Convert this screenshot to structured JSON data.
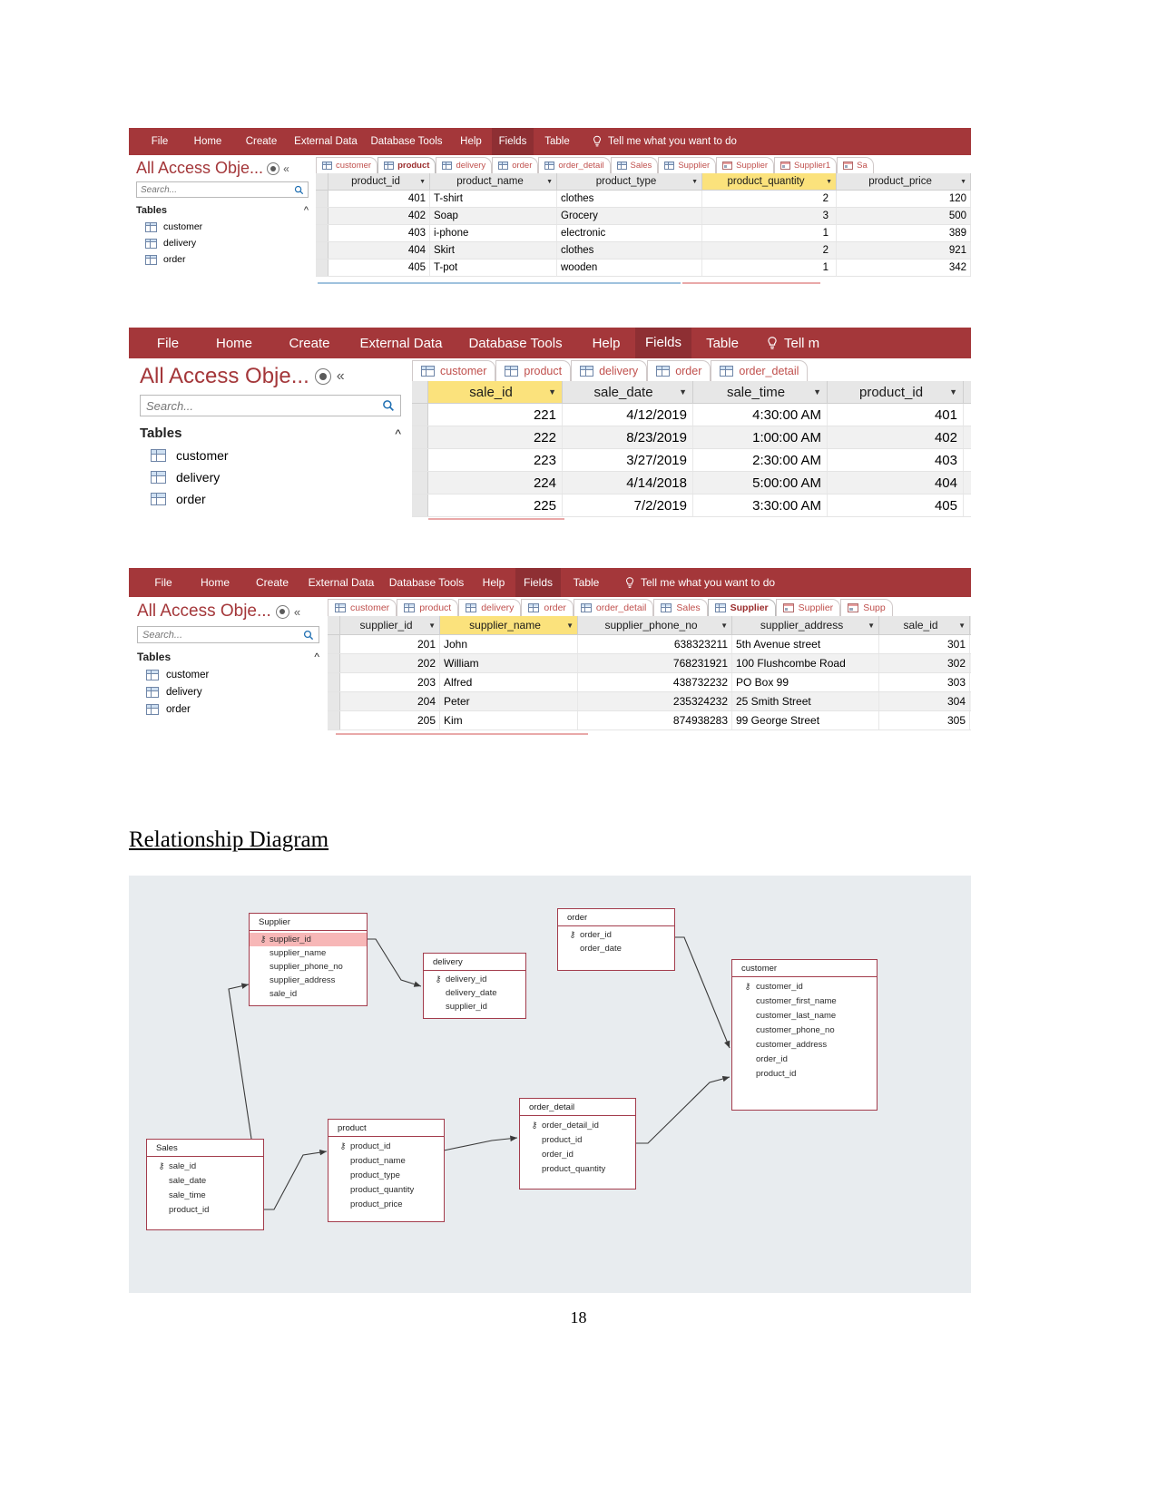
{
  "document": {
    "section_heading": "Relationship Diagram",
    "page_number": "18"
  },
  "icons": {
    "search": "search-icon",
    "bulb": "lightbulb-icon",
    "caret_down": "chevron-down-icon",
    "chevron_up": "chevron-up-icon",
    "collapse": "collapse-pane-icon",
    "eye": "shutter-bar-icon",
    "key": "primary-key-icon",
    "table": "table-icon"
  },
  "ribbon": {
    "tabs": [
      "File",
      "Home",
      "Create",
      "External Data",
      "Database Tools",
      "Help",
      "Fields",
      "Table"
    ],
    "active_tab": "Fields",
    "tell_me": "Tell me what you want to do",
    "tell_me_short": "Tell m",
    "color": "#a4373a"
  },
  "navpane": {
    "title": "All Access Obje...",
    "search_placeholder": "Search...",
    "group_label": "Tables",
    "items": [
      {
        "label": "customer"
      },
      {
        "label": "delivery"
      },
      {
        "label": "order"
      }
    ]
  },
  "screenshots": [
    {
      "id": "product-datasheet",
      "doc_tabs": [
        {
          "label": "customer",
          "type": "table",
          "active": false
        },
        {
          "label": "product",
          "type": "table",
          "active": true
        },
        {
          "label": "delivery",
          "type": "table",
          "active": false
        },
        {
          "label": "order",
          "type": "table",
          "active": false
        },
        {
          "label": "order_detail",
          "type": "table",
          "active": false
        },
        {
          "label": "Sales",
          "type": "table",
          "active": false
        },
        {
          "label": "Supplier",
          "type": "table",
          "active": false
        },
        {
          "label": "Supplier",
          "type": "form",
          "active": false
        },
        {
          "label": "Supplier1",
          "type": "form",
          "active": false
        },
        {
          "label": "Sa",
          "type": "form",
          "active": false
        }
      ],
      "columns": [
        {
          "name": "product_id",
          "selected": false
        },
        {
          "name": "product_name",
          "selected": false
        },
        {
          "name": "product_type",
          "selected": false
        },
        {
          "name": "product_quantity",
          "selected": true
        },
        {
          "name": "product_price",
          "selected": false
        }
      ],
      "rows": [
        {
          "product_id": "401",
          "product_name": "T-shirt",
          "product_type": "clothes",
          "product_quantity": "2",
          "product_price": "120"
        },
        {
          "product_id": "402",
          "product_name": "Soap",
          "product_type": "Grocery",
          "product_quantity": "3",
          "product_price": "500"
        },
        {
          "product_id": "403",
          "product_name": "i-phone",
          "product_type": "electronic",
          "product_quantity": "1",
          "product_price": "389"
        },
        {
          "product_id": "404",
          "product_name": "Skirt",
          "product_type": "clothes",
          "product_quantity": "2",
          "product_price": "921"
        },
        {
          "product_id": "405",
          "product_name": "T-pot",
          "product_type": "wooden",
          "product_quantity": "1",
          "product_price": "342"
        }
      ]
    },
    {
      "id": "sales-datasheet",
      "doc_tabs": [
        {
          "label": "customer",
          "type": "table",
          "active": false
        },
        {
          "label": "product",
          "type": "table",
          "active": false
        },
        {
          "label": "delivery",
          "type": "table",
          "active": false
        },
        {
          "label": "order",
          "type": "table",
          "active": false
        },
        {
          "label": "order_detail",
          "type": "table",
          "active": false
        }
      ],
      "columns": [
        {
          "name": "sale_id",
          "selected": true
        },
        {
          "name": "sale_date",
          "selected": false
        },
        {
          "name": "sale_time",
          "selected": false
        },
        {
          "name": "product_id",
          "selected": false
        }
      ],
      "rows": [
        {
          "sale_id": "221",
          "sale_date": "4/12/2019",
          "sale_time": "4:30:00 AM",
          "product_id": "401"
        },
        {
          "sale_id": "222",
          "sale_date": "8/23/2019",
          "sale_time": "1:00:00 AM",
          "product_id": "402"
        },
        {
          "sale_id": "223",
          "sale_date": "3/27/2019",
          "sale_time": "2:30:00 AM",
          "product_id": "403"
        },
        {
          "sale_id": "224",
          "sale_date": "4/14/2018",
          "sale_time": "5:00:00 AM",
          "product_id": "404"
        },
        {
          "sale_id": "225",
          "sale_date": "7/2/2019",
          "sale_time": "3:30:00 AM",
          "product_id": "405"
        }
      ]
    },
    {
      "id": "supplier-datasheet",
      "doc_tabs": [
        {
          "label": "customer",
          "type": "table",
          "active": false
        },
        {
          "label": "product",
          "type": "table",
          "active": false
        },
        {
          "label": "delivery",
          "type": "table",
          "active": false
        },
        {
          "label": "order",
          "type": "table",
          "active": false
        },
        {
          "label": "order_detail",
          "type": "table",
          "active": false
        },
        {
          "label": "Sales",
          "type": "table",
          "active": false
        },
        {
          "label": "Supplier",
          "type": "table",
          "active": true
        },
        {
          "label": "Supplier",
          "type": "form",
          "active": false
        },
        {
          "label": "Supp",
          "type": "form",
          "active": false
        }
      ],
      "columns": [
        {
          "name": "supplier_id",
          "selected": false
        },
        {
          "name": "supplier_name",
          "selected": true
        },
        {
          "name": "supplier_phone_no",
          "selected": false
        },
        {
          "name": "supplier_address",
          "selected": false
        },
        {
          "name": "sale_id",
          "selected": false
        }
      ],
      "rows": [
        {
          "supplier_id": "201",
          "supplier_name": "John",
          "supplier_phone_no": "638323211",
          "supplier_address": "5th Avenue street",
          "sale_id": "301"
        },
        {
          "supplier_id": "202",
          "supplier_name": "William",
          "supplier_phone_no": "768231921",
          "supplier_address": "100 Flushcombe Road",
          "sale_id": "302"
        },
        {
          "supplier_id": "203",
          "supplier_name": "Alfred",
          "supplier_phone_no": "438732232",
          "supplier_address": "PO Box 99",
          "sale_id": "303"
        },
        {
          "supplier_id": "204",
          "supplier_name": "Peter",
          "supplier_phone_no": "235324232",
          "supplier_address": "25 Smith Street",
          "sale_id": "304"
        },
        {
          "supplier_id": "205",
          "supplier_name": "Kim",
          "supplier_phone_no": "874938283",
          "supplier_address": "99 George Street",
          "sale_id": "305"
        }
      ]
    }
  ],
  "er_diagram": {
    "background": "#e8ecef",
    "border_color": "#a33c4c",
    "pk_highlight_color": "#f7b7b7",
    "entities": [
      {
        "name": "Supplier",
        "fields": [
          {
            "name": "supplier_id",
            "key": true,
            "highlight": true
          },
          {
            "name": "supplier_name",
            "key": false,
            "highlight": false
          },
          {
            "name": "supplier_phone_no",
            "key": false,
            "highlight": false
          },
          {
            "name": "supplier_address",
            "key": false,
            "highlight": false
          },
          {
            "name": "sale_id",
            "key": false,
            "highlight": false
          }
        ]
      },
      {
        "name": "delivery",
        "fields": [
          {
            "name": "delivery_id",
            "key": true,
            "highlight": false
          },
          {
            "name": "delivery_date",
            "key": false,
            "highlight": false
          },
          {
            "name": "supplier_id",
            "key": false,
            "highlight": false
          }
        ]
      },
      {
        "name": "order",
        "fields": [
          {
            "name": "order_id",
            "key": true,
            "highlight": false
          },
          {
            "name": "order_date",
            "key": false,
            "highlight": false
          }
        ]
      },
      {
        "name": "customer",
        "fields": [
          {
            "name": "customer_id",
            "key": true,
            "highlight": false
          },
          {
            "name": "customer_first_name",
            "key": false,
            "highlight": false
          },
          {
            "name": "customer_last_name",
            "key": false,
            "highlight": false
          },
          {
            "name": "customer_phone_no",
            "key": false,
            "highlight": false
          },
          {
            "name": "customer_address",
            "key": false,
            "highlight": false
          },
          {
            "name": "order_id",
            "key": false,
            "highlight": false
          },
          {
            "name": "product_id",
            "key": false,
            "highlight": false
          }
        ]
      },
      {
        "name": "Sales",
        "fields": [
          {
            "name": "sale_id",
            "key": true,
            "highlight": false
          },
          {
            "name": "sale_date",
            "key": false,
            "highlight": false
          },
          {
            "name": "sale_time",
            "key": false,
            "highlight": false
          },
          {
            "name": "product_id",
            "key": false,
            "highlight": false
          }
        ]
      },
      {
        "name": "product",
        "fields": [
          {
            "name": "product_id",
            "key": true,
            "highlight": false
          },
          {
            "name": "product_name",
            "key": false,
            "highlight": false
          },
          {
            "name": "product_type",
            "key": false,
            "highlight": false
          },
          {
            "name": "product_quantity",
            "key": false,
            "highlight": false
          },
          {
            "name": "product_price",
            "key": false,
            "highlight": false
          }
        ]
      },
      {
        "name": "order_detail",
        "fields": [
          {
            "name": "order_detail_id",
            "key": true,
            "highlight": false
          },
          {
            "name": "product_id",
            "key": false,
            "highlight": false
          },
          {
            "name": "order_id",
            "key": false,
            "highlight": false
          },
          {
            "name": "product_quantity",
            "key": false,
            "highlight": false
          }
        ]
      }
    ],
    "relationships": [
      {
        "from": "Supplier.supplier_id",
        "to": "delivery.supplier_id"
      },
      {
        "from": "Sales.sale_id",
        "to": "Supplier.sale_id"
      },
      {
        "from": "Sales.product_id",
        "to": "product.product_id"
      },
      {
        "from": "product.product_id",
        "to": "order_detail.product_id"
      },
      {
        "from": "order_detail.order_id",
        "to": "customer.product_id"
      },
      {
        "from": "order.order_id",
        "to": "customer.order_id"
      }
    ]
  }
}
